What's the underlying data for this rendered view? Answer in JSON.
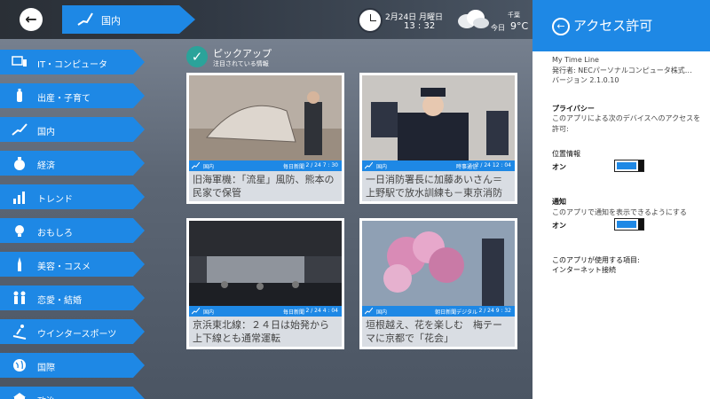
{
  "header": {
    "category": "国内",
    "date": "2月24日 月曜日",
    "time": "13 : 32",
    "city": "千葉",
    "today": "今日",
    "temperature": "9°C"
  },
  "sidebar": {
    "items": [
      {
        "label": "IT・コンピュータ"
      },
      {
        "label": "出産・子育て"
      },
      {
        "label": "国内"
      },
      {
        "label": "経済"
      },
      {
        "label": "トレンド"
      },
      {
        "label": "おもしろ"
      },
      {
        "label": "美容・コスメ"
      },
      {
        "label": "恋愛・結婚"
      },
      {
        "label": "ウインタースポーツ"
      },
      {
        "label": "国際"
      },
      {
        "label": "政治"
      }
    ]
  },
  "pickup": {
    "title": "ピックアップ",
    "subtitle": "注目されている情報"
  },
  "cards": [
    {
      "category": "国内",
      "source": "毎日新聞",
      "date": "2 / 24  7 : 30",
      "headline": "旧海軍機：「流星」風防、熊本の民家で保管"
    },
    {
      "category": "国内",
      "source": "時事通信",
      "date": "2 / 24  12 : 04",
      "headline": "一日消防署長に加藤あいさん＝上野駅で放水訓練も－東京消防庁"
    },
    {
      "category": "国内",
      "source": "毎日新聞",
      "date": "2 / 24  4 : 04",
      "headline": "京浜東北線：２４日は始発から上下線とも通常運転"
    },
    {
      "category": "国内",
      "source": "朝日新聞デジタル",
      "date": "2 / 24  9 : 32",
      "headline": "垣根越え、花を楽しむ　梅テーマに京都で「花会」"
    }
  ],
  "panel": {
    "title": "アクセス許可",
    "app_name": "My Time Line",
    "publisher": "発行者: NECパーソナルコンピュータ株式…",
    "version": "バージョン 2.1.0.10",
    "privacy_heading": "プライバシー",
    "privacy_desc": "このアプリによる次のデバイスへのアクセスを許可:",
    "location_label": "位置情報",
    "location_state": "オン",
    "location_on": 1,
    "notify_label": "通知",
    "notify_desc": "このアプリで通知を表示できるようにする",
    "notify_state": "オン",
    "notify_on": 1,
    "uses_label": "このアプリが使用する項目:",
    "uses_value": "インターネット接続"
  },
  "colors": {
    "accent": "#1e88e5",
    "check": "#2ba39a"
  }
}
